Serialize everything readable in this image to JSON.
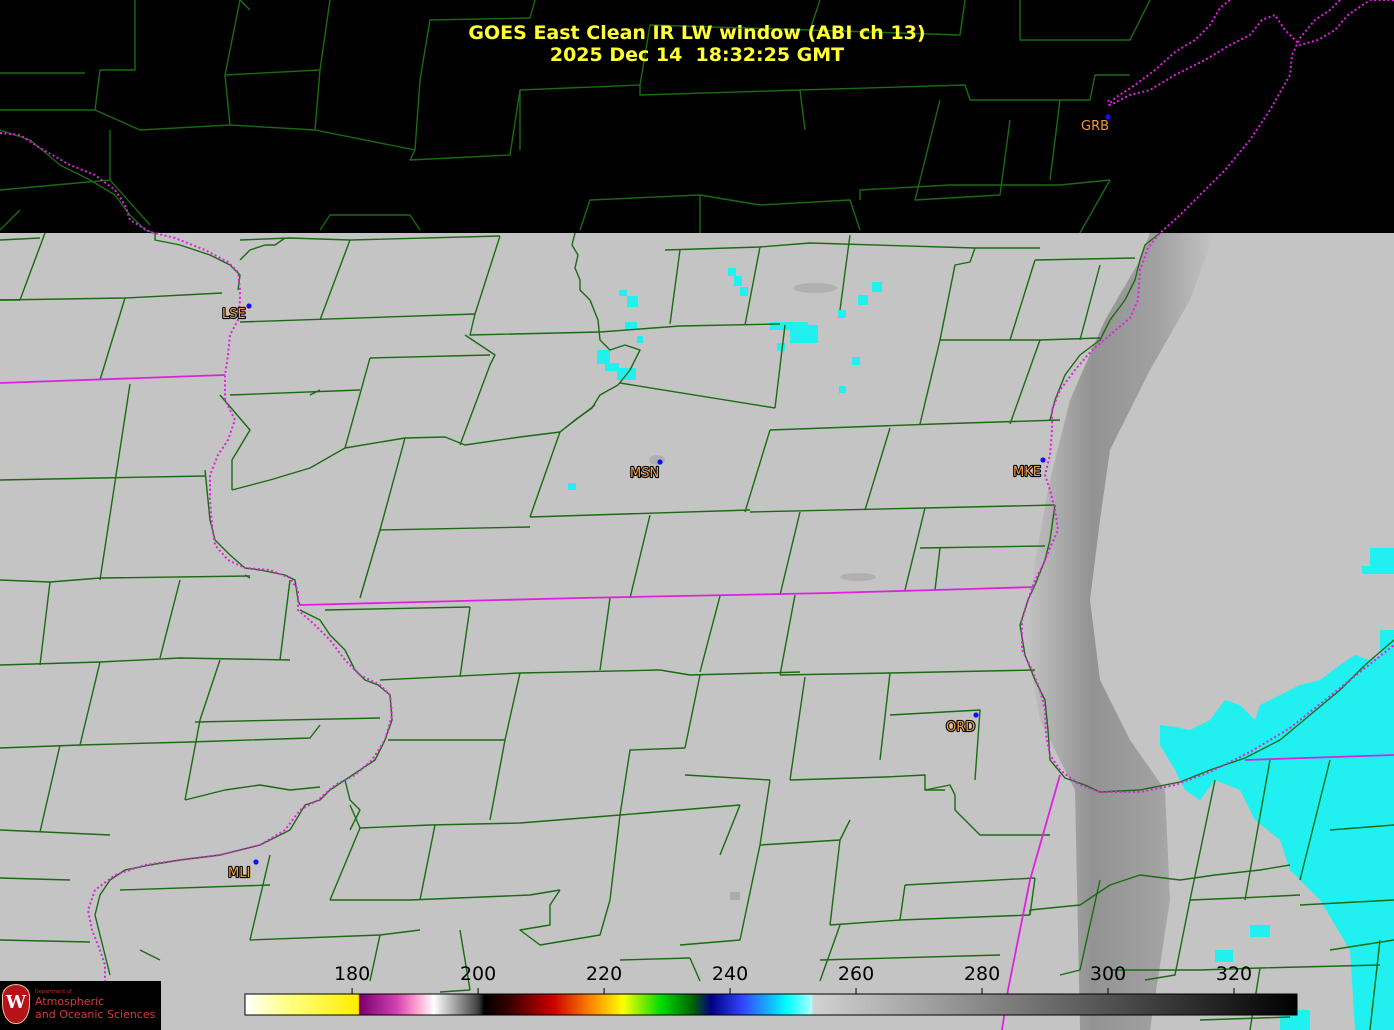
{
  "title": {
    "line1": "GOES East Clean IR LW window (ABI ch 13)",
    "line2": "2025 Dec 14  18:32:25 GMT"
  },
  "cities": [
    {
      "code": "GRB"
    },
    {
      "code": "LSE"
    },
    {
      "code": "MSN"
    },
    {
      "code": "MKE"
    },
    {
      "code": "ORD"
    },
    {
      "code": "MLI"
    }
  ],
  "colorbar": {
    "unit_note": "",
    "ticks": [
      "180",
      "200",
      "220",
      "240",
      "260",
      "280",
      "300",
      "320"
    ],
    "tick_values": [
      180,
      200,
      220,
      240,
      260,
      280,
      300,
      320
    ],
    "range": [
      163,
      330
    ],
    "stops": [
      {
        "value": 163,
        "color": "#ffffff"
      },
      {
        "value": 170,
        "color": "#ffff80"
      },
      {
        "value": 181,
        "color": "#ffee00"
      },
      {
        "value": 181.2,
        "color": "#7a0070"
      },
      {
        "value": 187,
        "color": "#d040b0"
      },
      {
        "value": 190,
        "color": "#ff99cc"
      },
      {
        "value": 193,
        "color": "#ffffff"
      },
      {
        "value": 200,
        "color": "#404040"
      },
      {
        "value": 201,
        "color": "#000000"
      },
      {
        "value": 205,
        "color": "#3a0000"
      },
      {
        "value": 212,
        "color": "#cc0000"
      },
      {
        "value": 218,
        "color": "#ff8800"
      },
      {
        "value": 223,
        "color": "#ffff00"
      },
      {
        "value": 229,
        "color": "#00dd00"
      },
      {
        "value": 234,
        "color": "#006600"
      },
      {
        "value": 237,
        "color": "#000080"
      },
      {
        "value": 242,
        "color": "#3344ff"
      },
      {
        "value": 249,
        "color": "#00ffff"
      },
      {
        "value": 253,
        "color": "#aaffff"
      },
      {
        "value": 253.1,
        "color": "#d2d2d2"
      },
      {
        "value": 330,
        "color": "#000000"
      }
    ]
  },
  "colors": {
    "county_lines": "#1a6b12",
    "state_lines": "#e020e0",
    "land_gray": "#c4c4c4",
    "cold_cloud": "#20f0f0",
    "city_dot": "#1010ff",
    "title": "#ffff33"
  },
  "logo": {
    "small": "Department of",
    "line1": "Atmospheric",
    "line2": "and Oceanic Sciences",
    "seal_letter": "W"
  }
}
